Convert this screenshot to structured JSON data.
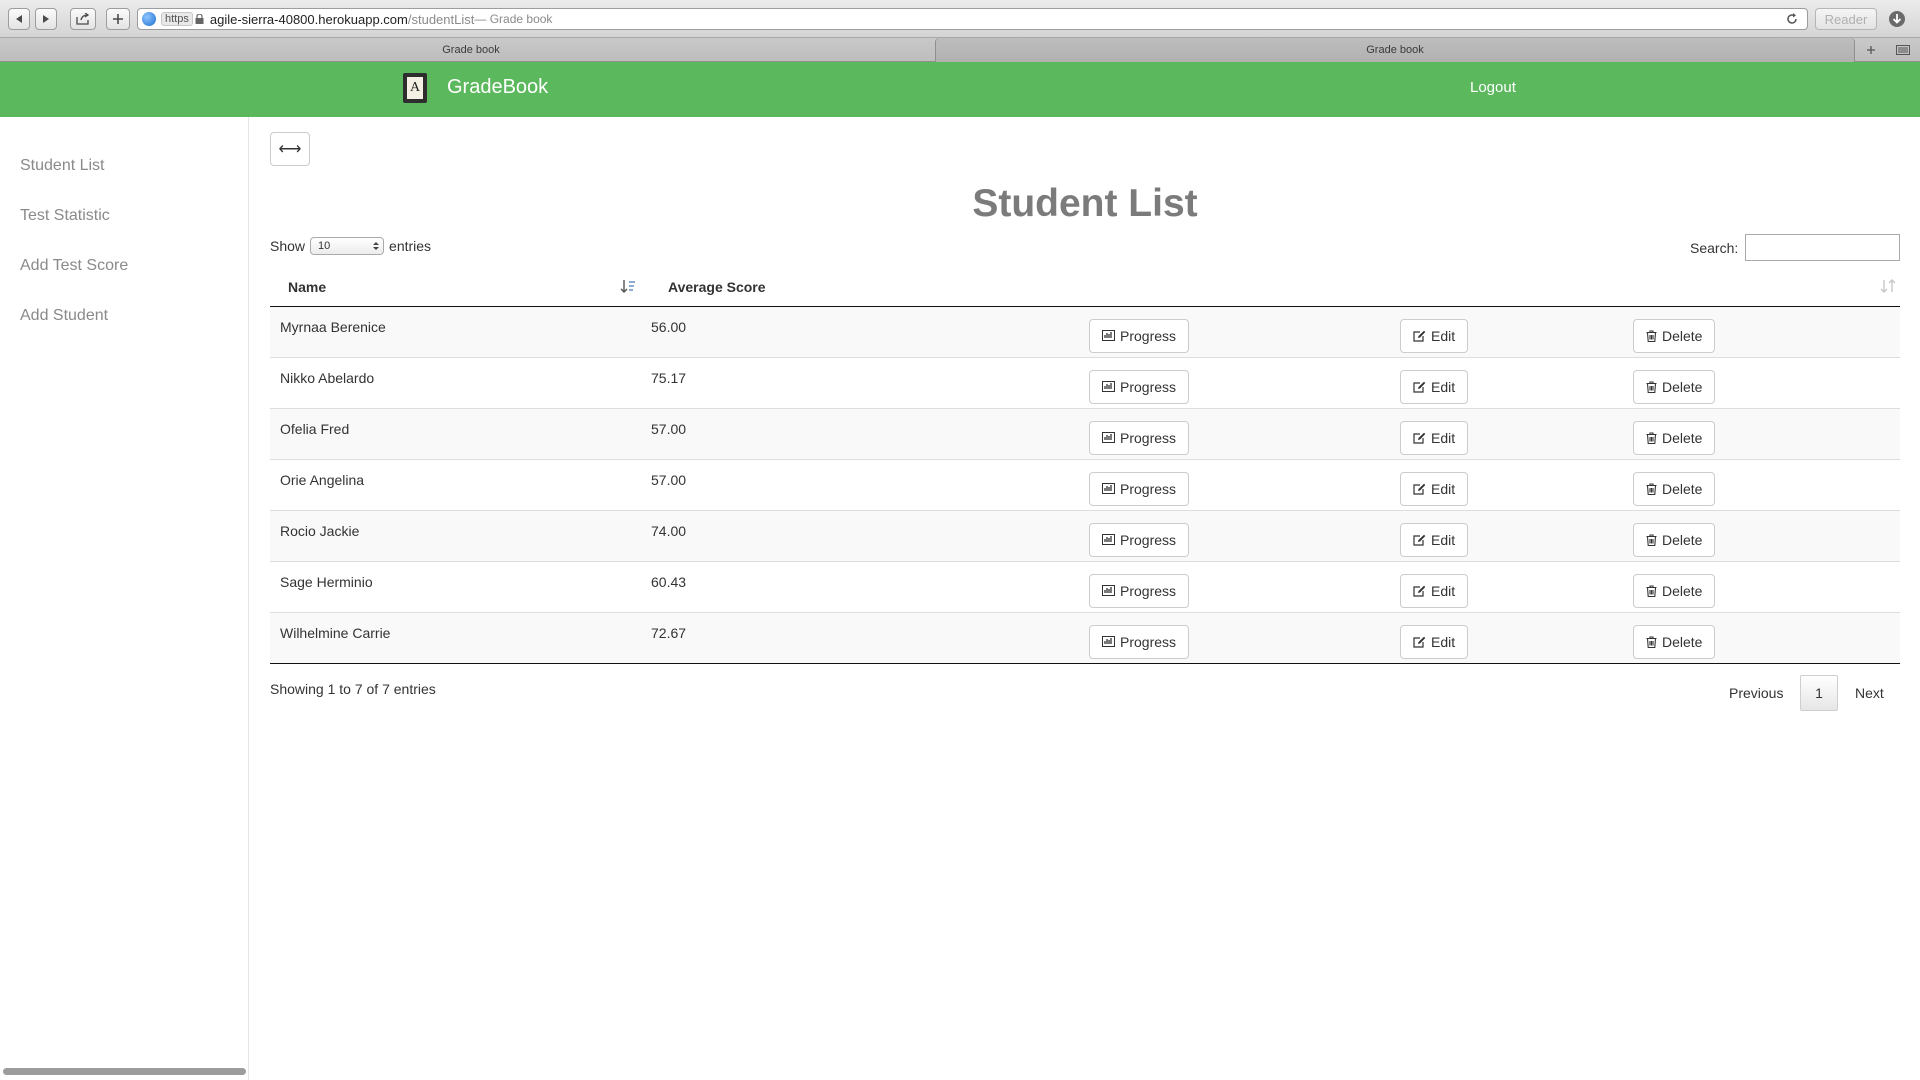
{
  "browser": {
    "url_scheme": "https",
    "url_host": "agile-sierra-40800.herokuapp.com",
    "url_path": "/studentList",
    "url_title_sep": " — Grade book",
    "reader_label": "Reader",
    "tabs": [
      {
        "label": "Grade book",
        "active": true
      },
      {
        "label": "Grade book",
        "active": false
      }
    ]
  },
  "navbar": {
    "logo_glyph": "A",
    "brand": "GradeBook",
    "logout_label": "Logout",
    "color": "#5cb85c"
  },
  "sidebar": {
    "items": [
      {
        "label": "Student List"
      },
      {
        "label": "Test Statistic"
      },
      {
        "label": "Add Test Score"
      },
      {
        "label": "Add Student"
      }
    ]
  },
  "main": {
    "toggle_glyph": "⟷",
    "title": "Student List",
    "show_label": "Show",
    "entries_label": "entries",
    "page_length": "10",
    "search_label": "Search:",
    "search_value": "",
    "columns": [
      "Name",
      "Average Score"
    ],
    "rows": [
      {
        "name": "Myrnaa Berenice",
        "score": "56.00"
      },
      {
        "name": "Nikko Abelardo",
        "score": "75.17"
      },
      {
        "name": "Ofelia Fred",
        "score": "57.00"
      },
      {
        "name": "Orie Angelina",
        "score": "57.00"
      },
      {
        "name": "Rocio Jackie",
        "score": "74.00"
      },
      {
        "name": "Sage Herminio",
        "score": "60.43"
      },
      {
        "name": "Wilhelmine Carrie",
        "score": "72.67"
      }
    ],
    "actions": {
      "progress_label": "Progress",
      "edit_label": "Edit",
      "delete_label": "Delete"
    },
    "info": "Showing 1 to 7 of 7 entries",
    "pagination": {
      "previous_label": "Previous",
      "current_page": "1",
      "next_label": "Next"
    }
  }
}
